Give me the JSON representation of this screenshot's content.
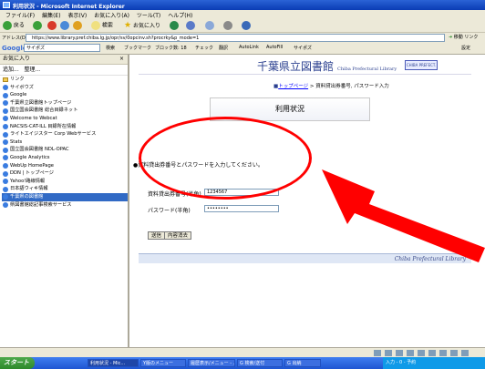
{
  "window": {
    "title": "利用状況 - Microsoft Internet Explorer"
  },
  "menu": [
    "ファイル(F)",
    "編集(E)",
    "表示(V)",
    "お気に入り(A)",
    "ツール(T)",
    "ヘルプ(H)"
  ],
  "toolbar": {
    "back": "戻る",
    "search": "検索",
    "favorites": "お気に入り"
  },
  "address": {
    "label": "アドレス(D)",
    "url": "https://www.library.pref.chiba.lg.jp/opr/sv/0opcinv.sh?procrky&p_mode=1",
    "go": "移動",
    "links": "リンク"
  },
  "google": {
    "logo": "Google",
    "box": "サイポズ",
    "items": [
      "検索",
      "ブックマーク",
      "ブロック数: 18",
      "チェック",
      "翻訳",
      "AutoLink",
      "AutoFill",
      "サイポズ",
      "設定"
    ]
  },
  "sidebar": {
    "title": "お気に入り",
    "tools": [
      "追加...",
      "整理..."
    ],
    "items": [
      {
        "label": "リンク",
        "type": "folder"
      },
      {
        "label": "サイボウズ",
        "type": "link"
      },
      {
        "label": "Google",
        "type": "link"
      },
      {
        "label": "千葉県立図書館トップページ",
        "type": "link"
      },
      {
        "label": "国立国会図書館 総合目録ネット",
        "type": "link"
      },
      {
        "label": "Welcome to Webcat",
        "type": "link"
      },
      {
        "label": "NACSIS-CAT-ILL 目録所在情報",
        "type": "link"
      },
      {
        "label": "ライトエイジスター Corp Webサービス",
        "type": "link"
      },
      {
        "label": "Stats",
        "type": "link"
      },
      {
        "label": "国立国会図書館 NDL-OPAC",
        "type": "link"
      },
      {
        "label": "Google Analytics",
        "type": "link"
      },
      {
        "label": "WebUp HomePage",
        "type": "link"
      },
      {
        "label": "DDN | トップページ",
        "type": "link"
      },
      {
        "label": "Yahoo!路線情報",
        "type": "link"
      },
      {
        "label": "日本語ウィキ情報",
        "type": "link"
      },
      {
        "label": "千葉県の図書館",
        "type": "link",
        "selected": true
      },
      {
        "label": "県図書館総記事検索サービス",
        "type": "link"
      }
    ]
  },
  "page": {
    "library_name": "千葉県立図書館",
    "library_name_en": "Chiba Prefectural Library",
    "logo_text": "CHIBA PREFECT.",
    "breadcrumb_link": "トップページ",
    "breadcrumb_rest": " > 資料貸出券番号, パスワード入力",
    "heading": "利用状況",
    "prompt": "●資料貸出券番号とパスワードを入力してください。",
    "card_label": "資料貸出券番号(半角)",
    "card_value": "1234567",
    "password_label": "パスワード(半角)",
    "password_value": "••••••••",
    "btn_submit": "送信",
    "btn_clear": "内容消去",
    "footer": "Chiba Prefectural Library"
  },
  "annotation": {
    "color": "#ff0000"
  },
  "taskbar": {
    "start": "スタート",
    "tasks": [
      "利用状況 - Mic...",
      "Y版のメニュー",
      "履歴表示/メニュー - ...",
      "G 検索/送付",
      "G 出納"
    ],
    "tray": "入力 - 0 - 予約"
  }
}
